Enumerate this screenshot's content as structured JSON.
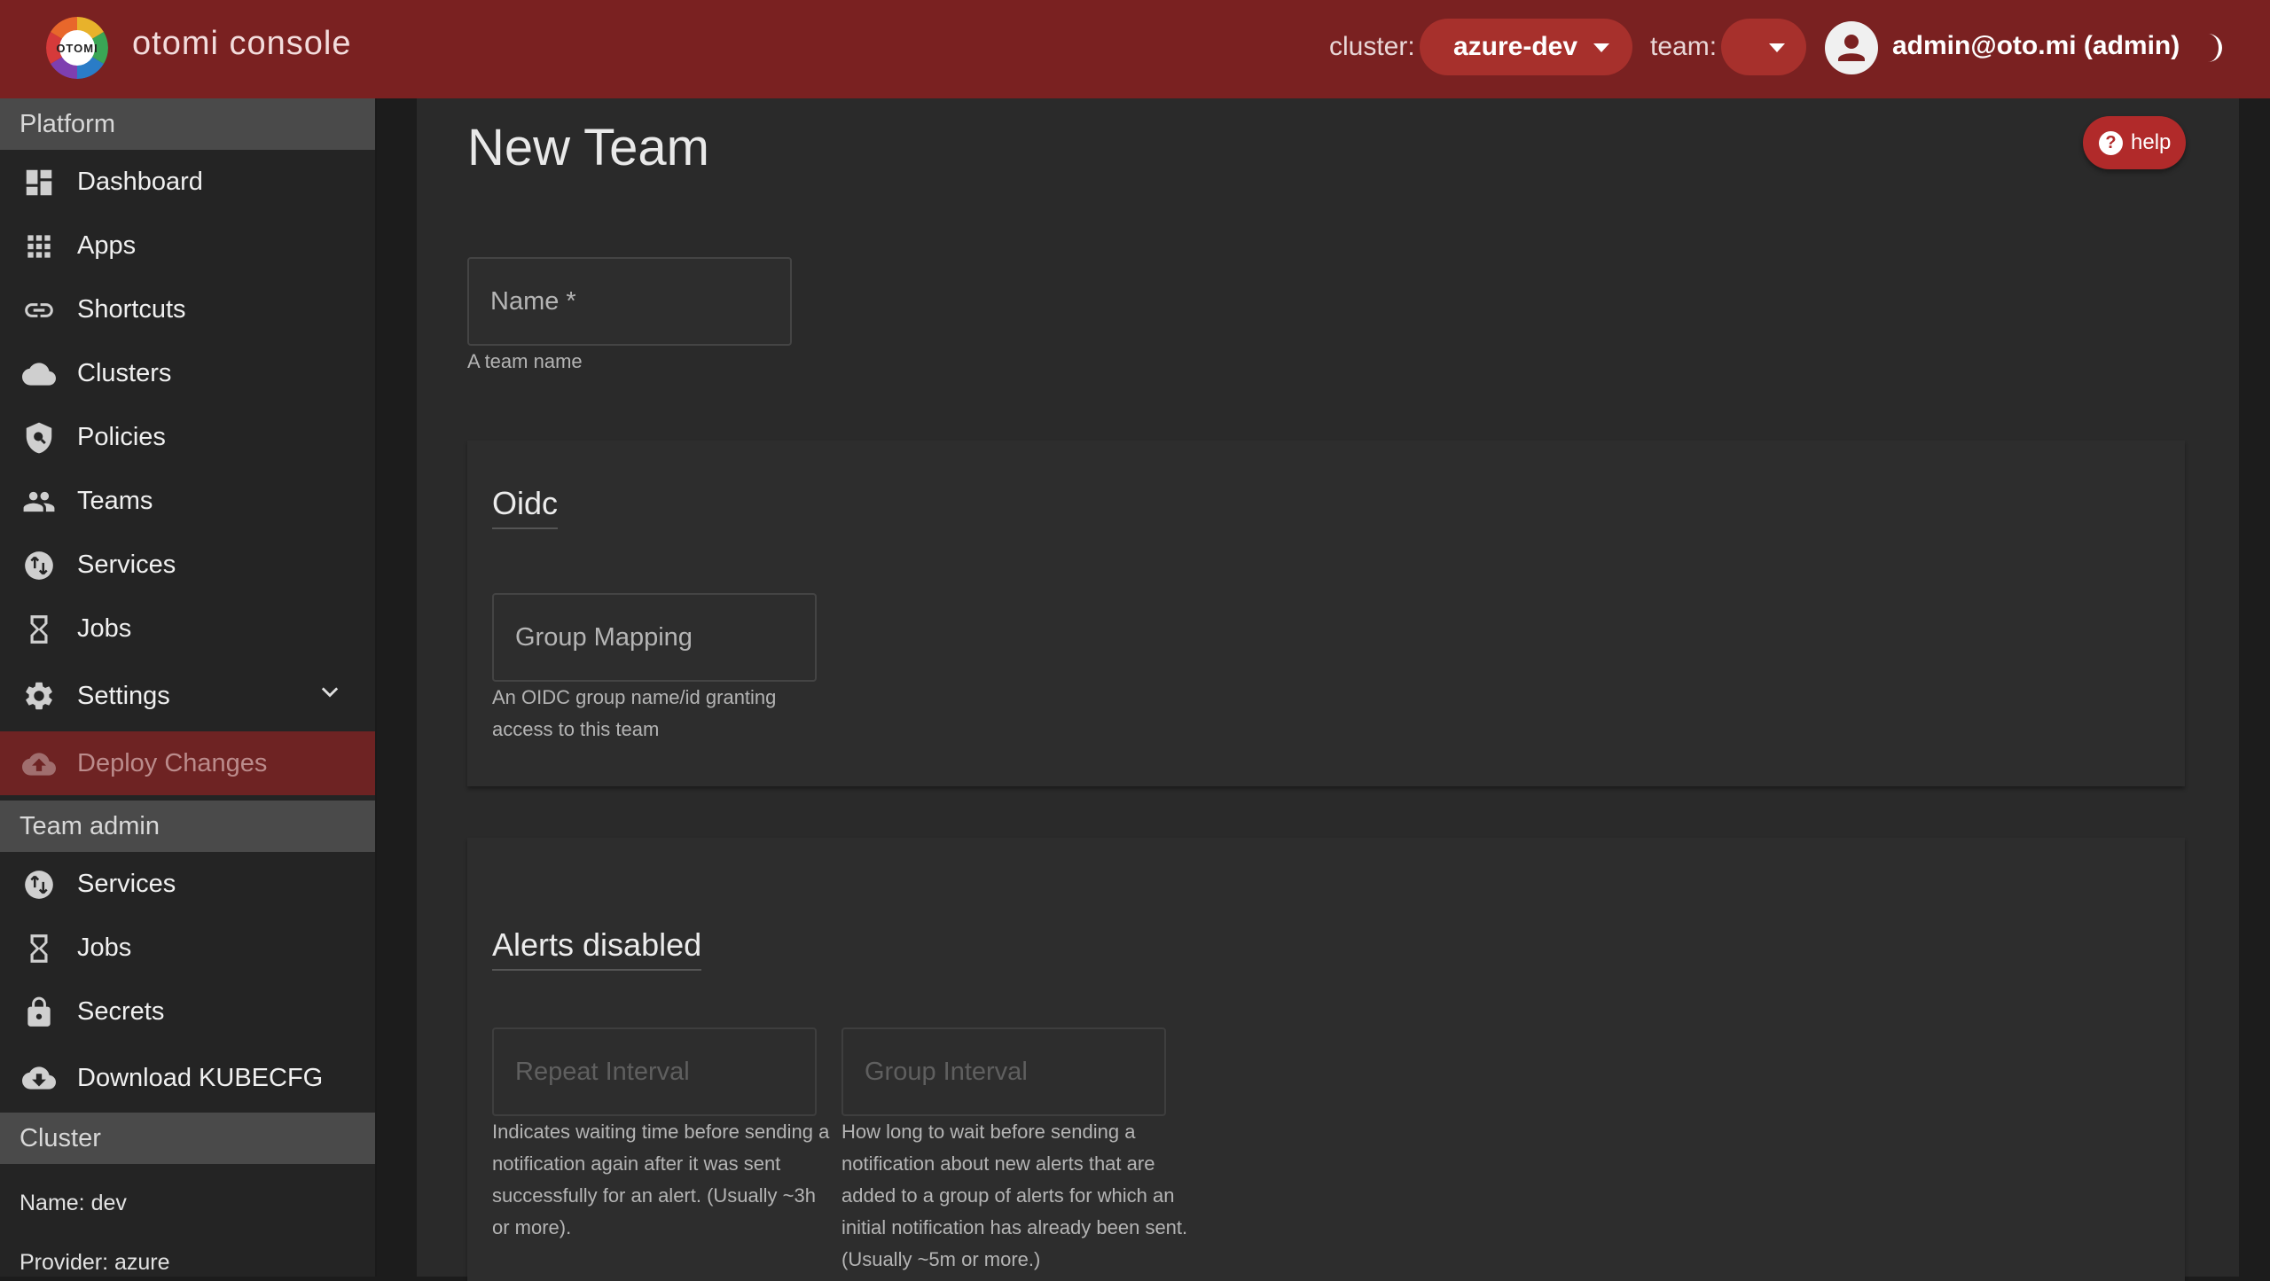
{
  "header": {
    "logo_text": "OTOMI",
    "brand": "otomi console",
    "cluster_label": "cluster:",
    "cluster_value": "azure-dev",
    "team_label": "team:",
    "team_value": "",
    "user": "admin@oto.mi (admin)",
    "accent_color": "#7a2121"
  },
  "sidebar": {
    "platform_title": "Platform",
    "platform_items": [
      {
        "label": "Dashboard",
        "icon": "dashboard-icon"
      },
      {
        "label": "Apps",
        "icon": "apps-grid-icon"
      },
      {
        "label": "Shortcuts",
        "icon": "link-icon"
      },
      {
        "label": "Clusters",
        "icon": "cloud-icon"
      },
      {
        "label": "Policies",
        "icon": "shield-search-icon"
      },
      {
        "label": "Teams",
        "icon": "people-icon"
      },
      {
        "label": "Services",
        "icon": "swap-circle-icon"
      },
      {
        "label": "Jobs",
        "icon": "hourglass-icon"
      },
      {
        "label": "Settings",
        "icon": "gear-icon"
      },
      {
        "label": "Deploy Changes",
        "icon": "cloud-upload-icon"
      }
    ],
    "team_title": "Team admin",
    "team_items": [
      {
        "label": "Services",
        "icon": "swap-circle-icon"
      },
      {
        "label": "Jobs",
        "icon": "hourglass-icon"
      },
      {
        "label": "Secrets",
        "icon": "lock-icon"
      },
      {
        "label": "Download KUBECFG",
        "icon": "cloud-download-icon"
      }
    ],
    "cluster_title": "Cluster",
    "cluster_name": "Name: dev",
    "cluster_provider": "Provider: azure"
  },
  "main": {
    "title": "New Team",
    "help_label": "help",
    "name_field": {
      "label": "Name *",
      "helper": "A team name"
    },
    "oidc": {
      "title": "Oidc",
      "group_mapping": {
        "label": "Group Mapping",
        "helper": "An OIDC group name/id granting access to this team"
      }
    },
    "alerts": {
      "title": "Alerts disabled",
      "repeat_interval": {
        "label": "Repeat Interval",
        "helper": "Indicates waiting time before sending a notification again after it was sent successfully for an alert. (Usually ~3h or more)."
      },
      "group_interval": {
        "label": "Group Interval",
        "helper": "How long to wait before sending a notification about new alerts that are added to a group of alerts for which an initial notification has already been sent. (Usually ~5m or more.)"
      }
    }
  }
}
